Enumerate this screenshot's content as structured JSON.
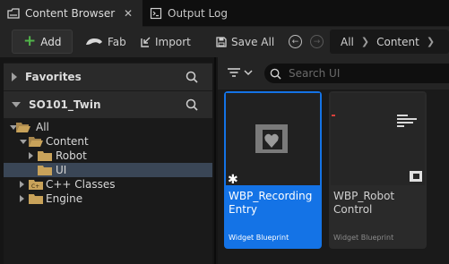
{
  "tabs": [
    {
      "label": "Content Browser",
      "close": "✕"
    },
    {
      "label": "Output Log"
    }
  ],
  "toolbar": {
    "add_label": "Add",
    "fab_label": "Fab",
    "import_label": "Import",
    "save_all_label": "Save All"
  },
  "breadcrumb": [
    "All",
    "Content"
  ],
  "sections": {
    "favorites": "Favorites",
    "project": "SO101_Twin"
  },
  "tree": [
    {
      "label": "All",
      "expanded": true
    },
    {
      "label": "Content",
      "expanded": true
    },
    {
      "label": "Robot",
      "expanded": false
    },
    {
      "label": "UI",
      "selected": true
    },
    {
      "label": "C++ Classes",
      "expanded": false
    },
    {
      "label": "Engine",
      "expanded": false
    }
  ],
  "search": {
    "placeholder": "Search UI"
  },
  "assets": [
    {
      "name": "WBP_Recording Entry",
      "type": "Widget Blueprint",
      "selected": true
    },
    {
      "name": "WBP_Robot Control",
      "type": "Widget Blueprint",
      "selected": false
    }
  ],
  "colors": {
    "accent": "#1473e6",
    "add": "#51b54a",
    "folder": "#c8a25a",
    "tree_selection": "#3a4656"
  }
}
